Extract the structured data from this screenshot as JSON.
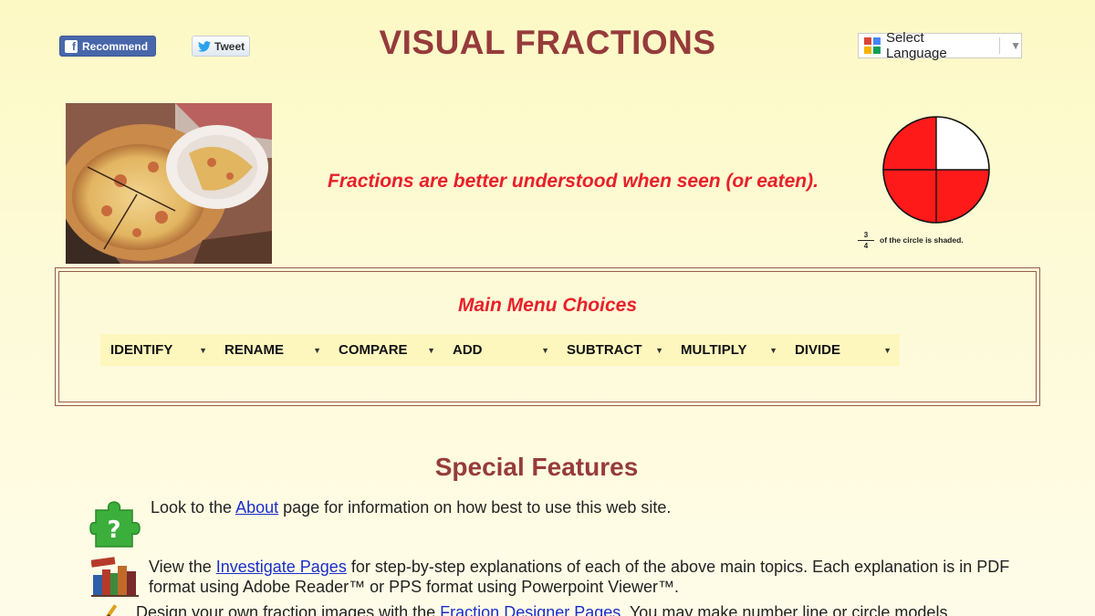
{
  "header": {
    "facebook_label": "Recommend",
    "twitter_label": "Tweet",
    "title": "VISUAL FRACTIONS",
    "language_label": "Select Language"
  },
  "hero": {
    "tagline": "Fractions are better understood when seen (or eaten).",
    "fraction_numerator": "3",
    "fraction_denominator": "4",
    "fraction_caption": "of the circle is shaded."
  },
  "main_menu": {
    "title": "Main Menu Choices",
    "items": [
      {
        "label": "IDENTIFY"
      },
      {
        "label": "RENAME"
      },
      {
        "label": "COMPARE"
      },
      {
        "label": "ADD"
      },
      {
        "label": "SUBTRACT"
      },
      {
        "label": "MULTIPLY"
      },
      {
        "label": "DIVIDE"
      }
    ]
  },
  "features": {
    "title": "Special Features",
    "items": [
      {
        "icon": "puzzle-question-icon",
        "before": "Look to the ",
        "link": "About",
        "after": " page for information on how best to use this web site."
      },
      {
        "icon": "books-icon",
        "before": "View the ",
        "link": "Investigate Pages",
        "after": " for step-by-step explanations of each of the above main topics. Each explanation is in PDF format using Adobe Reader™ or PPS format using Powerpoint Viewer™."
      },
      {
        "icon": "pencil-icon",
        "before": "Design your own fraction images with the ",
        "link": "Fraction Designer Pages",
        "after": ". You may make number line or circle models."
      }
    ]
  },
  "colors": {
    "title": "#963b3b",
    "accent_red": "#e8202a",
    "link": "#1a2ecc",
    "background": "#fdf9c4"
  }
}
